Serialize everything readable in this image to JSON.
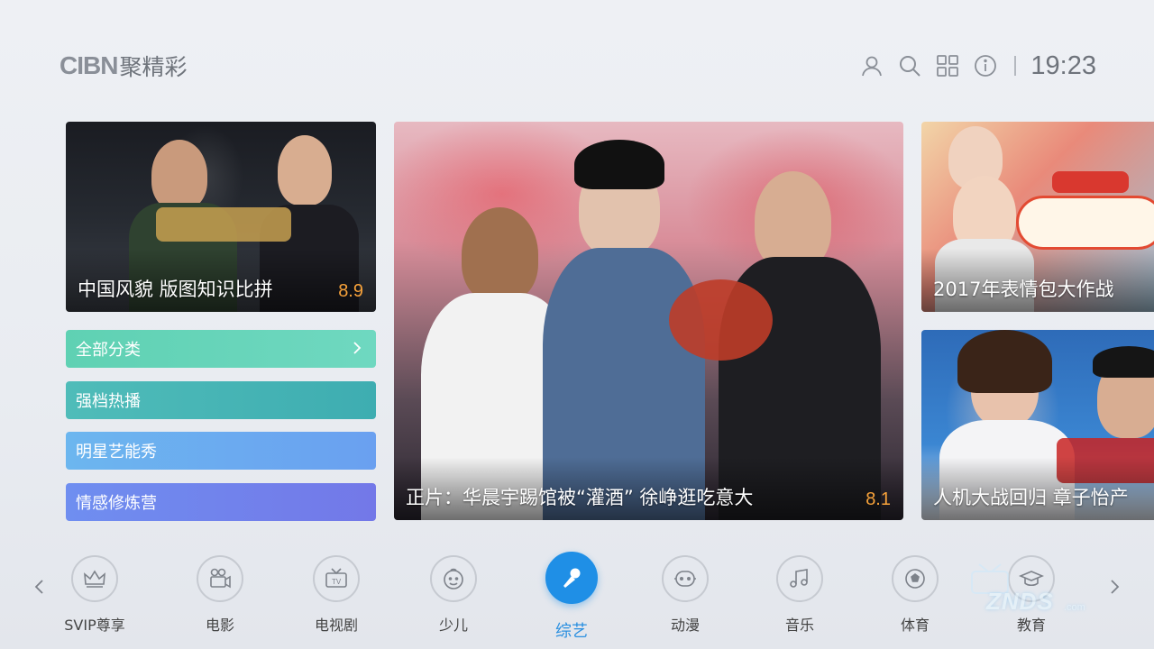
{
  "header": {
    "logo_latin": "CIBN",
    "logo_cn": "聚精彩",
    "time": "19:23",
    "icons": [
      "user-icon",
      "search-icon",
      "apps-grid-icon",
      "info-icon"
    ]
  },
  "featured": [
    {
      "title": "中国风貌 版图知识比拼",
      "score": "8.9"
    },
    {
      "title": "正片：华晨宇踢馆被“灌酒” 徐峥逛吃意大",
      "score": "8.1"
    },
    {
      "title": "2017年表情包大作战",
      "score": ""
    },
    {
      "title": "人机大战回归 章子怡产",
      "score": ""
    }
  ],
  "categories": [
    {
      "label": "全部分类"
    },
    {
      "label": "强档热播"
    },
    {
      "label": "明星艺能秀"
    },
    {
      "label": "情感修炼营"
    }
  ],
  "nav": [
    {
      "label": "SVIP尊享",
      "icon": "crown-icon"
    },
    {
      "label": "电影",
      "icon": "movie-camera-icon"
    },
    {
      "label": "电视剧",
      "icon": "tv-icon"
    },
    {
      "label": "少儿",
      "icon": "kid-face-icon"
    },
    {
      "label": "综艺",
      "icon": "microphone-icon",
      "active": true
    },
    {
      "label": "动漫",
      "icon": "cartoon-face-icon"
    },
    {
      "label": "音乐",
      "icon": "music-note-icon"
    },
    {
      "label": "体育",
      "icon": "soccer-ball-icon"
    },
    {
      "label": "教育",
      "icon": "graduation-cap-icon"
    }
  ],
  "watermark": {
    "text": "ZNDS",
    "sub": ".com"
  },
  "colors": {
    "accent": "#1f8fe6",
    "score": "#f7a23a"
  }
}
